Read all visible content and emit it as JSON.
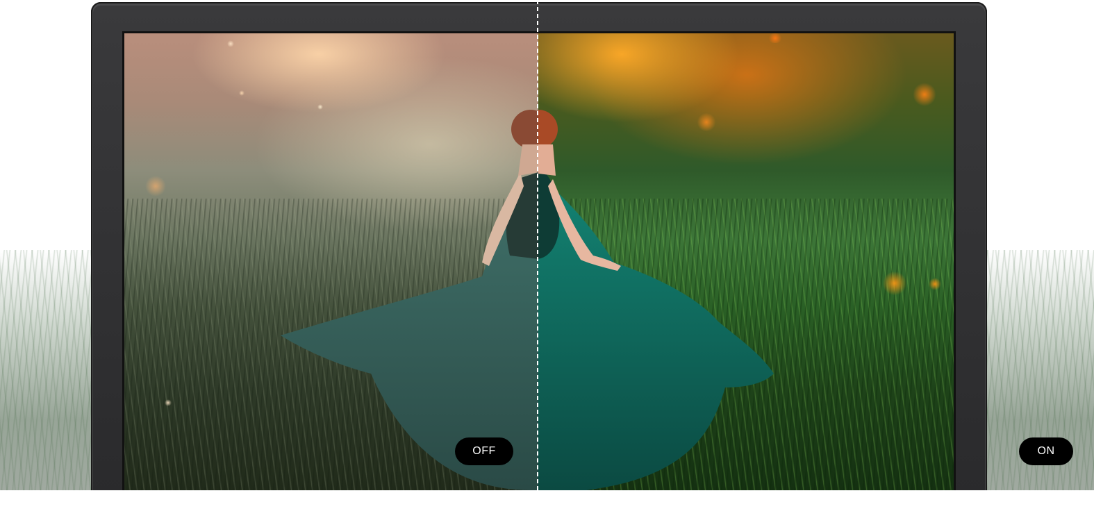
{
  "comparison": {
    "off_label": "OFF",
    "on_label": "ON"
  },
  "colors": {
    "pill_background": "#000000",
    "pill_text": "#ffffff",
    "bezel": "#2f2f31",
    "divider": "#ffffff",
    "dress_off": "#3d6d66",
    "dress_on": "#0f6e60"
  },
  "icons": {
    "divider": "dashed-divider-line"
  }
}
